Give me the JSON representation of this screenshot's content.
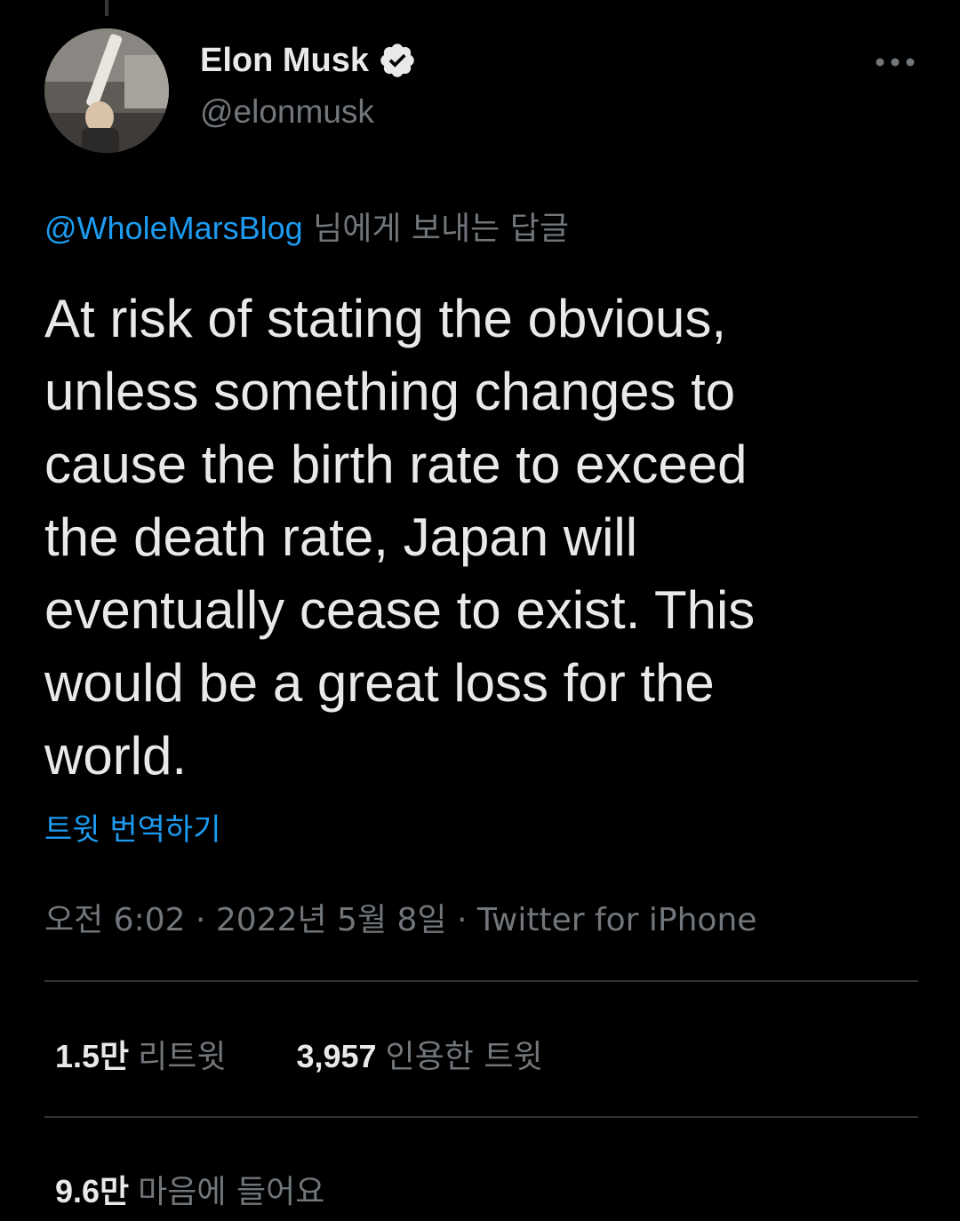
{
  "author": {
    "display_name": "Elon Musk",
    "handle": "@elonmusk",
    "verified": true
  },
  "icons": {
    "verified": "verified-badge-icon",
    "more": "more-dots-icon"
  },
  "reply_to": {
    "mention": "@WholeMarsBlog",
    "suffix": "님에게 보내는 답글"
  },
  "tweet": {
    "text": "At risk of stating the obvious,\nunless something changes to\ncause the birth rate to exceed\nthe death rate, Japan will\neventually cease to exist. This\nwould be a great loss for the\nworld.",
    "translate_label": "트윗 번역하기",
    "meta": "오전 6:02 · 2022년 5월 8일 · Twitter for iPhone"
  },
  "stats": {
    "retweets": {
      "count": "1.5만",
      "label": "리트윗"
    },
    "quotes": {
      "count": "3,957",
      "label": "인용한 트윗"
    },
    "likes": {
      "count": "9.6만",
      "label": "마음에 들어요"
    }
  },
  "colors": {
    "background": "#000000",
    "text_primary": "#e7e9ea",
    "text_secondary": "#71767b",
    "accent": "#1d9bf0",
    "divider": "#2f3336"
  }
}
